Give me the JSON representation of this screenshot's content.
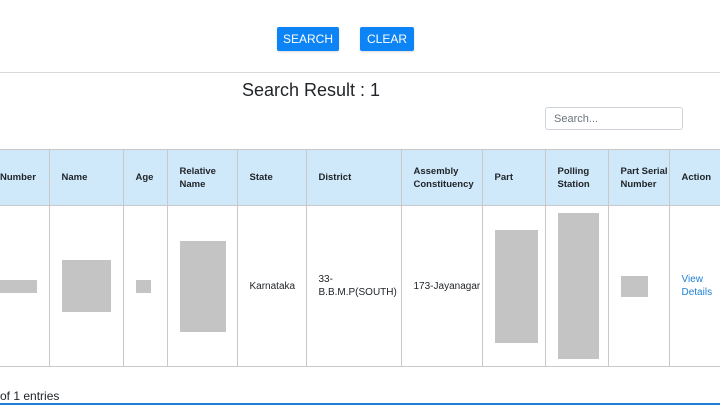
{
  "buttons": {
    "search": "SEARCH",
    "clear": "CLEAR"
  },
  "result": {
    "title": "Search Result : 1"
  },
  "search": {
    "placeholder": "Search..."
  },
  "table": {
    "headers": {
      "number": "Number",
      "name": "Name",
      "age": "Age",
      "relative_name": "Relative Name",
      "state": "State",
      "district": "District",
      "assembly": "Assembly Constituency",
      "part": "Part",
      "polling_station": "Polling Station",
      "part_serial": "Part Serial Number",
      "action": "Action"
    },
    "row": {
      "state": "Karnataka",
      "district": "33-B.B.M.P(SOUTH)",
      "assembly": "173-Jayanagar",
      "action": "View Details"
    }
  },
  "footer": {
    "info": "of 1 entries"
  },
  "colors": {
    "header_bg": "#cfe9fb",
    "button": "#0d84f5",
    "link": "#1f7fd6",
    "redaction": "#c4c4c4"
  }
}
